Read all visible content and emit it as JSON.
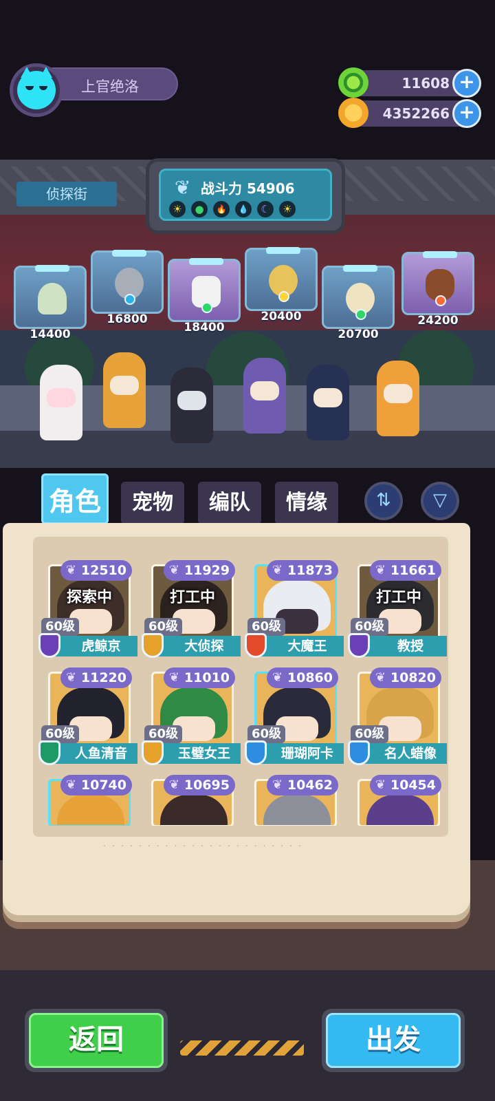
{
  "player": {
    "name": "上官绝洛",
    "avatar_icon": "cat-face-icon"
  },
  "currencies": [
    {
      "icon": "green-gem-coin-icon",
      "amount": "11608",
      "color": "#6fd43a"
    },
    {
      "icon": "gold-planet-coin-icon",
      "amount": "4352266",
      "color": "#f2a62b"
    }
  ],
  "location": "侦探街",
  "team_power": {
    "label": "战斗力",
    "value": "54906",
    "elements": [
      "☀",
      "●",
      "🔥",
      "💧",
      "☾",
      "☀"
    ]
  },
  "displays": [
    {
      "value": "14400"
    },
    {
      "value": "16800"
    },
    {
      "value": "18400"
    },
    {
      "value": "20400"
    },
    {
      "value": "20700"
    },
    {
      "value": "24200"
    }
  ],
  "tabs": {
    "roles": "角色",
    "pets": "宠物",
    "teams": "编队",
    "bonds": "情缘",
    "active": "roles"
  },
  "sort_icon": "sort-icon",
  "filter_icon": "filter-icon",
  "cards": [
    {
      "power": "12510",
      "status": "探索中",
      "level": "60级",
      "name": "虎鲸京",
      "rank_color": "#6b3fb5",
      "hair": "#3e2e2a"
    },
    {
      "power": "11929",
      "status": "打工中",
      "level": "60级",
      "name": "大侦探",
      "rank_color": "#e6a12a",
      "hair": "#2c2220"
    },
    {
      "power": "11873",
      "status": "",
      "level": "60级",
      "name": "大魔王",
      "rank_color": "#e34a2a",
      "hair": "#e9ecf1"
    },
    {
      "power": "11661",
      "status": "打工中",
      "level": "60级",
      "name": "教授",
      "rank_color": "#6b3fb5",
      "hair": "#2b2b30"
    },
    {
      "power": "11220",
      "status": "",
      "level": "60级",
      "name": "人鱼清音",
      "rank_color": "#1f9a66",
      "hair": "#22232f"
    },
    {
      "power": "11010",
      "status": "",
      "level": "60级",
      "name": "玉璧女王",
      "rank_color": "#e6a12a",
      "hair": "#2f8a45"
    },
    {
      "power": "10860",
      "status": "",
      "level": "60级",
      "name": "珊瑚阿卡",
      "rank_color": "#2e8de0",
      "hair": "#2b2a3a"
    },
    {
      "power": "10820",
      "status": "",
      "level": "60级",
      "name": "名人蜡像",
      "rank_color": "#2e8de0",
      "hair": "#d9a34a"
    },
    {
      "power": "10740"
    },
    {
      "power": "10695"
    },
    {
      "power": "10462"
    },
    {
      "power": "10454"
    }
  ],
  "buttons": {
    "back": "返回",
    "go": "出发"
  }
}
